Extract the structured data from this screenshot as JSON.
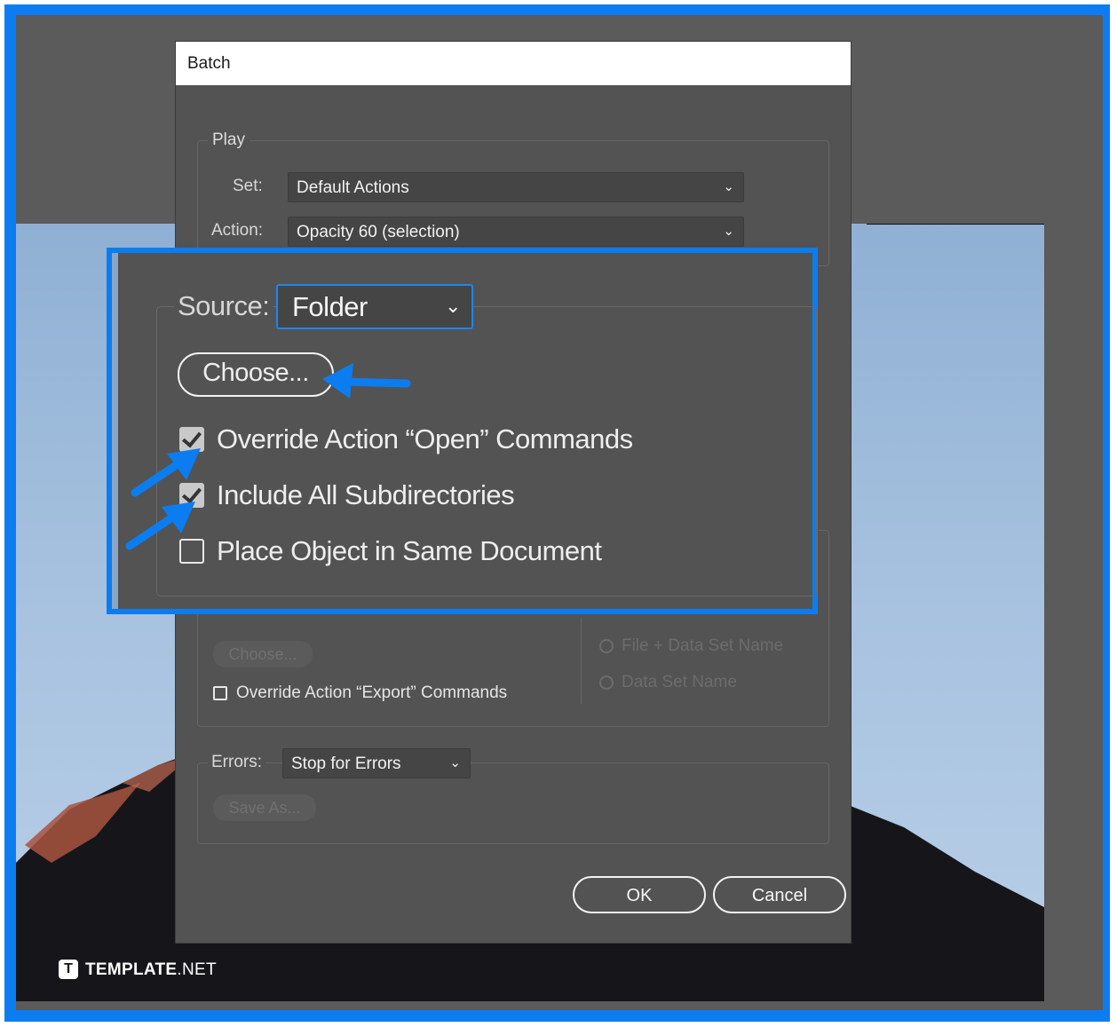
{
  "dialog": {
    "title": "Batch",
    "play": {
      "group_label": "Play",
      "set_label": "Set:",
      "set_value": "Default Actions",
      "action_label": "Action:",
      "action_value": "Opacity 60 (selection)"
    },
    "source": {
      "label": "Source:",
      "value": "Folder",
      "choose_label": "Choose...",
      "options": [
        {
          "label": "Override Action “Open” Commands",
          "checked": true
        },
        {
          "label": "Include All Subdirectories",
          "checked": true
        },
        {
          "label": "Place Object in Same Document",
          "checked": false
        }
      ]
    },
    "destination": {
      "choose_label": "Choose...",
      "override_export_label": "Override Action “Export” Commands",
      "override_export_checked": false,
      "radio_file_data_set": "File + Data Set Name",
      "radio_data_set": "Data Set Name"
    },
    "errors": {
      "label": "Errors:",
      "value": "Stop for Errors",
      "save_as_label": "Save As..."
    },
    "ok_label": "OK",
    "cancel_label": "Cancel"
  },
  "watermark": {
    "logo_letter": "T",
    "brand": "TEMPLATE",
    "suffix": ".NET"
  },
  "colors": {
    "highlight": "#0b7df0",
    "dialog_bg": "#535353",
    "stage_bg": "#5b5b5b"
  },
  "icons": [
    "chevron-down-icon",
    "checkmark-icon",
    "arrow-pointer-icon",
    "radio-icon"
  ]
}
